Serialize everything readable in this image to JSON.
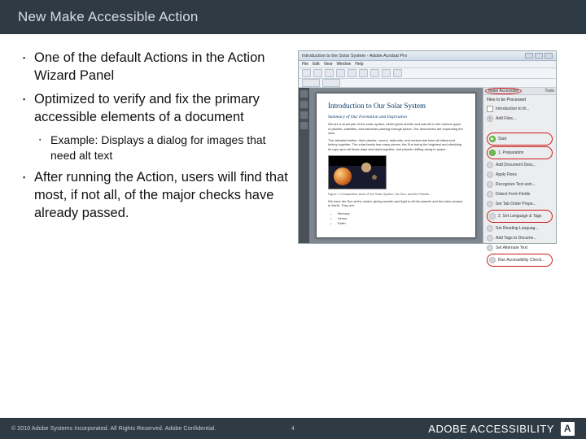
{
  "slide": {
    "title": "New Make Accessible Action",
    "bullets": [
      "One of the default Actions in the Action Wizard Panel",
      "Optimized to verify and fix the primary accessible elements of a document",
      "After running the Action, users will find that most, if not all, of the major checks have already passed."
    ],
    "sub_bullet": "Example: Displays a dialog for images that need alt text"
  },
  "screenshot": {
    "window_title": "Introduction to the Solar System - Adobe Acrobat Pro",
    "menu": [
      "File",
      "Edit",
      "View",
      "Window",
      "Help"
    ],
    "doc": {
      "h1": "Introduction to Our Solar System",
      "h2": "Summary of Our Formation and Inspiration",
      "p1": "We are a small part of the solar system, which gives shelter and warmth to the various types of planets, satellites, and asteroids passing through space. Our discoveries are expanding the view.",
      "p2": "The celestial bodies, their planets, moons, asteroids, and meteoroids have all influenced history together. The solar family has many pieces, the Sun being the brightest and shedding its rays upon all these days and night together, and planets drifting along in space.",
      "caption": "Figure 1   Comparative sizes of the Solar System, the Sun, and the Planets",
      "p3": "We have the Sun at the center, giving warmth and light to all the planets and the stars closest to Earth. They are:",
      "list": [
        "Mercury",
        "Venus",
        "Earth"
      ]
    },
    "panel": {
      "header_button": "Make Accessible",
      "tools_label": "Tools",
      "files_title": "Files to be Processed",
      "file_item": "Introduction to th...",
      "actions": [
        {
          "icon": "green",
          "label": "Start"
        },
        {
          "icon": "green",
          "label": "1. Preparation"
        },
        {
          "icon": "gray",
          "label": "Add Document Desc..."
        },
        {
          "icon": "gray",
          "label": "Apply Fixes"
        },
        {
          "icon": "gray",
          "label": "Recognize Text usin..."
        },
        {
          "icon": "gray",
          "label": "Detect Form Fields"
        },
        {
          "icon": "gray",
          "label": "Set Tab Order Prope..."
        }
      ],
      "highlighted": "2. Set Language & Tags",
      "more": [
        {
          "label": "Set Reading Languag..."
        },
        {
          "label": "Add Tags to Docume..."
        },
        {
          "label": "Set Alternate Text"
        }
      ],
      "final": "Run Accessibility Check..."
    }
  },
  "footer": {
    "copyright": "© 2010 Adobe Systems Incorporated.  All Rights Reserved.  Adobe Confidential.",
    "page_number": "4",
    "brand": "ADOBE ACCESSIBILITY",
    "logo_letter": "A"
  }
}
